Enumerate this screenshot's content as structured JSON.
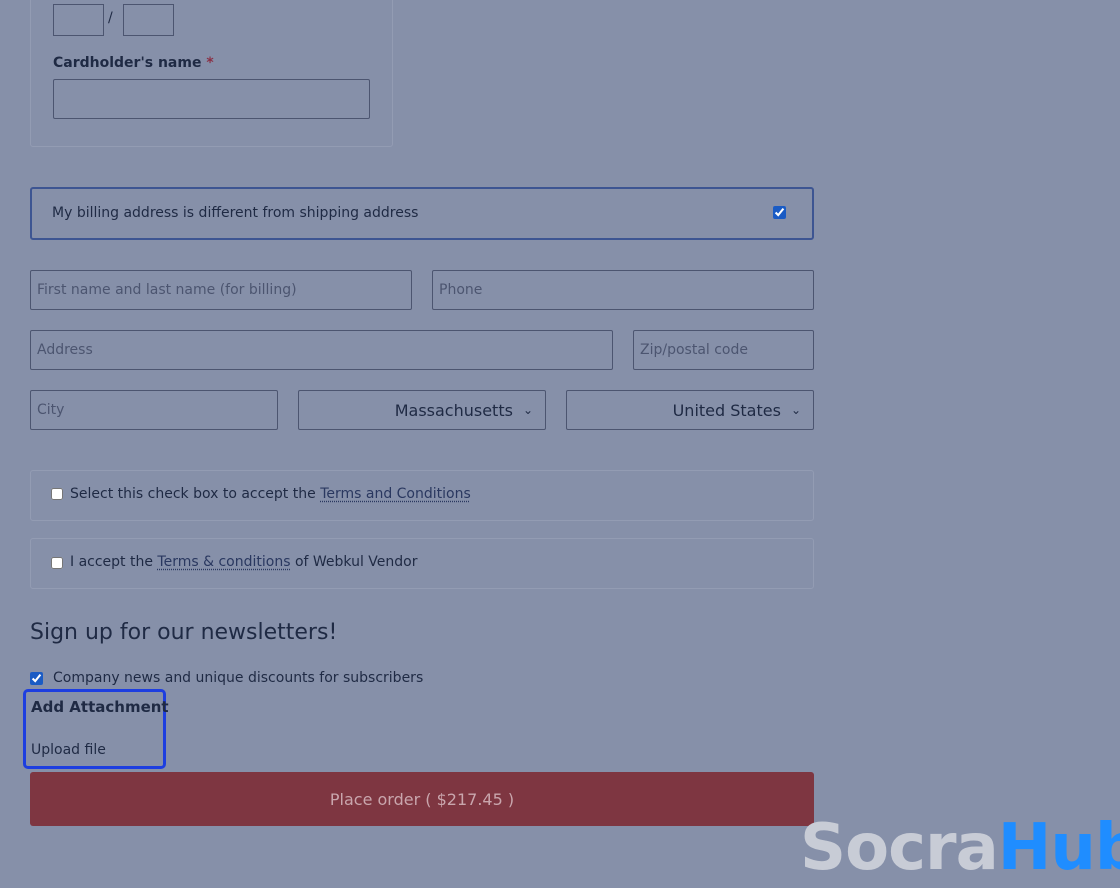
{
  "card": {
    "expiry_separator": "/",
    "cardholder_label": "Cardholder's name",
    "required_mark": "*"
  },
  "billing": {
    "different_label": "My billing address is different from shipping address",
    "different_checked": true,
    "name_placeholder": "First name and last name (for billing)",
    "phone_placeholder": "Phone",
    "address_placeholder": "Address",
    "zip_placeholder": "Zip/postal code",
    "city_placeholder": "City",
    "state_value": "Massachusetts",
    "country_value": "United States"
  },
  "terms": {
    "terms1_prefix": "Select this check box to accept the ",
    "terms1_link": "Terms and Conditions",
    "terms2_prefix": "I accept the ",
    "terms2_link": "Terms & conditions",
    "terms2_suffix": " of Webkul Vendor"
  },
  "newsletter": {
    "title": "Sign up for our newsletters!",
    "option_label": "Company news and unique discounts for subscribers",
    "option_checked": true
  },
  "attachment": {
    "title": "Add Attachment",
    "upload_label": "Upload file"
  },
  "order": {
    "button_label": "Place order ( $217.45 )"
  },
  "brand": {
    "logo_part1": "Socra",
    "logo_part2": "Hub"
  },
  "colors": {
    "overlay_bg": "#8690a9",
    "accent_blue": "#1d3ee0",
    "order_button": "#7e3641",
    "logo_blue": "#1f8dff"
  }
}
